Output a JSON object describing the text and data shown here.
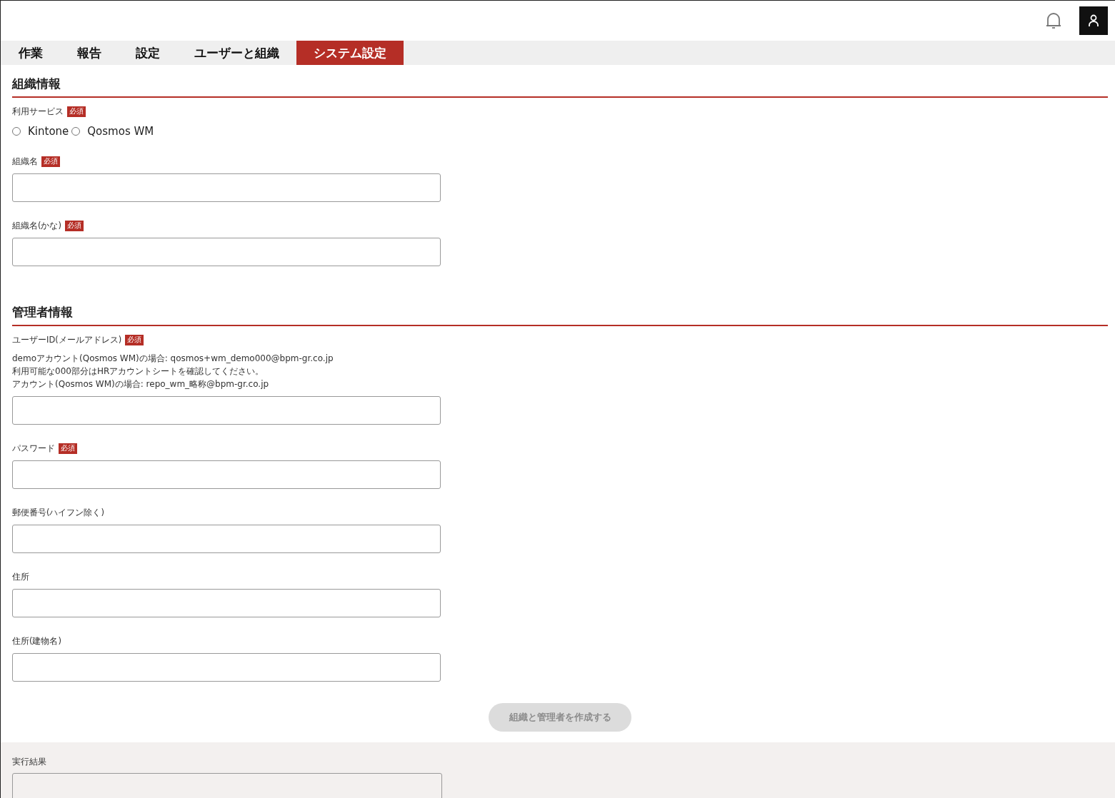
{
  "tabs": [
    {
      "label": "作業",
      "selected": false
    },
    {
      "label": "報告",
      "selected": false
    },
    {
      "label": "設定",
      "selected": false
    },
    {
      "label": "ユーザーと組織",
      "selected": false
    },
    {
      "label": "システム設定",
      "selected": true
    }
  ],
  "sections": [
    {
      "title": "組織情報",
      "fields": [
        {
          "kind": "radio",
          "label": "利用サービス",
          "badge": "必須",
          "options": [
            {
              "label": "Kintone",
              "selected": false
            },
            {
              "label": "Qosmos WM",
              "selected": false
            }
          ]
        },
        {
          "kind": "text",
          "label": "組織名",
          "badge": "必須"
        },
        {
          "kind": "text",
          "label": "組織名(かな)",
          "badge": "必須"
        }
      ]
    },
    {
      "title": "管理者情報",
      "fields": [
        {
          "kind": "text",
          "label": "ユーザーID(メールアドレス)",
          "badge": "必須",
          "help": [
            "demoアカウント(Qosmos WM)の場合: qosmos+wm_demo000@bpm-gr.co.jp",
            "利用可能な000部分はHRアカウントシートを確認してください。",
            "アカウント(Qosmos WM)の場合: repo_wm_略称@bpm-gr.co.jp"
          ]
        },
        {
          "kind": "text",
          "label": "パスワード",
          "badge": "必須"
        },
        {
          "kind": "text",
          "label": "郵便番号(ハイフン除く)"
        },
        {
          "kind": "text",
          "label": "住所"
        },
        {
          "kind": "text",
          "label": "住所(建物名)"
        }
      ]
    }
  ],
  "submit": {
    "label": "組織と管理者を作成する",
    "disabled": true
  },
  "result": {
    "label": "実行結果"
  }
}
